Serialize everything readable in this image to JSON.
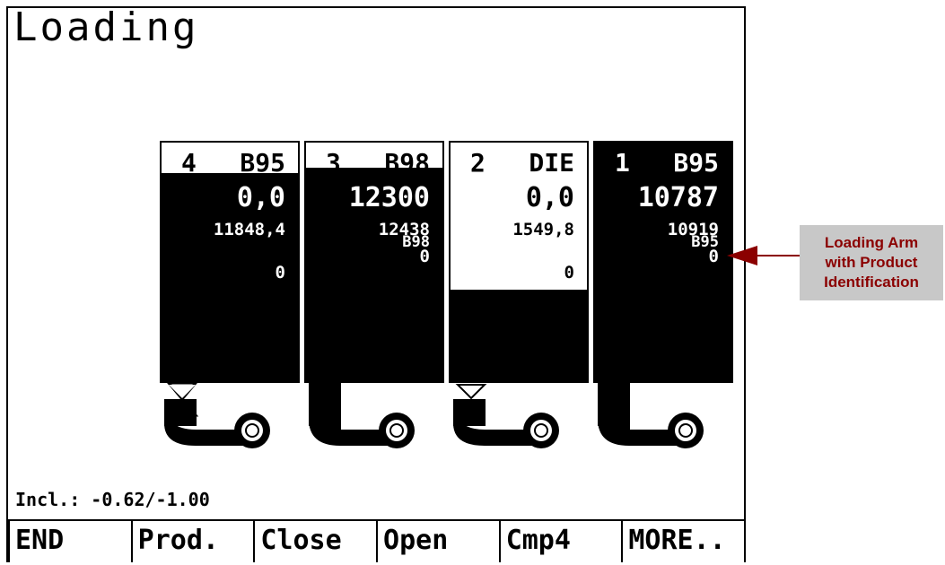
{
  "screen": {
    "title": "Loading"
  },
  "compartments": [
    {
      "num": "4",
      "product": "B95",
      "volume": "0,0",
      "total": "11848,4",
      "code": "",
      "extra": "0",
      "fill": 0.06
    },
    {
      "num": "3",
      "product": "B98",
      "volume": "12300",
      "total": "12438",
      "code": "B98",
      "extra": "0",
      "fill": 0.05
    },
    {
      "num": "2",
      "product": "DIE",
      "volume": "0,0",
      "total": "1549,8",
      "code": "",
      "extra": "0",
      "fill": 0.6
    },
    {
      "num": "1",
      "product": "B95",
      "volume": "10787",
      "total": "10919",
      "code": "B95",
      "extra": "0",
      "fill": 0.0
    }
  ],
  "status": {
    "inclination": "Incl.: -0.62/-1.00"
  },
  "softkeys": [
    "END",
    "Prod.",
    "Close",
    "Open",
    "Cmp4",
    "MORE.."
  ],
  "callout": {
    "lines": [
      "Loading Arm",
      "with Product",
      "Identification"
    ]
  },
  "colors": {
    "callout_bg": "#c8c8c8",
    "callout_text": "#8b0000"
  }
}
